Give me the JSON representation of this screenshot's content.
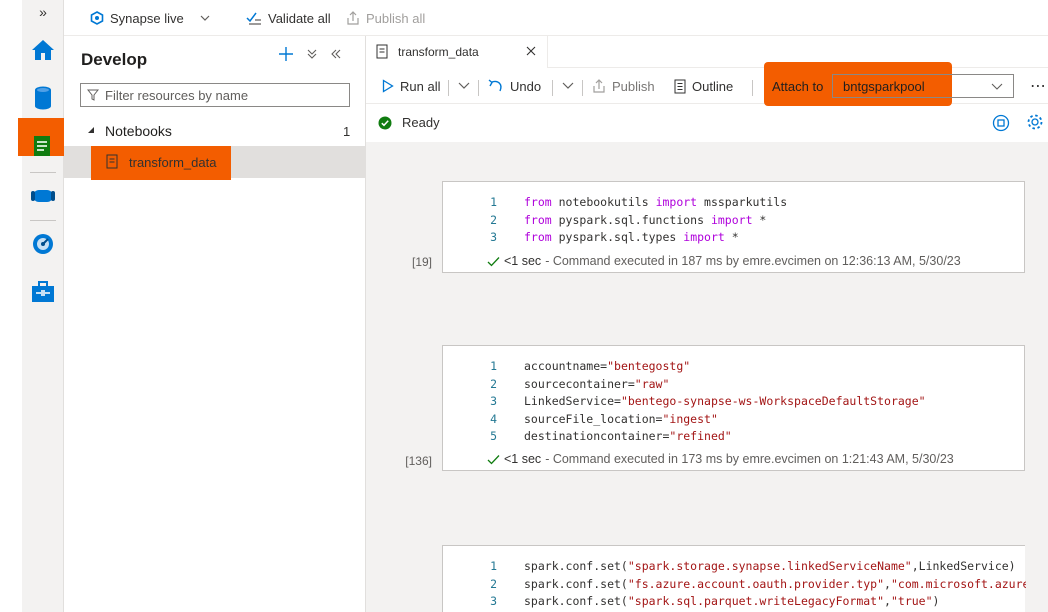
{
  "topbar": {
    "collapse_glyph": "»",
    "mode_label": "Synapse live",
    "validate_label": "Validate all",
    "publish_label": "Publish all"
  },
  "rail": {
    "items": [
      "home-icon",
      "data-icon",
      "develop-icon",
      "integrate-icon",
      "monitor-icon",
      "manage-icon"
    ]
  },
  "explorer": {
    "title": "Develop",
    "filter_placeholder": "Filter resources by name",
    "folder_label": "Notebooks",
    "folder_count": "1",
    "notebook_name": "transform_data"
  },
  "editor": {
    "tab_label": "transform_data",
    "toolbar": {
      "run_all": "Run all",
      "undo": "Undo",
      "publish": "Publish",
      "outline": "Outline",
      "attach_label": "Attach to",
      "attach_value": "bntgsparkpool"
    },
    "status": "Ready",
    "cells": [
      {
        "exec_count": "[19]",
        "status_time": "<1 sec",
        "status_text": "- Command executed in 187 ms by emre.evcimen on 12:36:13 AM, 5/30/23"
      },
      {
        "exec_count": "[136]",
        "status_time": "<1 sec",
        "status_text": "- Command executed in 173 ms by emre.evcimen on 1:21:43 AM, 5/30/23"
      },
      {
        "exec_count": "",
        "status_time": "",
        "status_text": ""
      }
    ]
  },
  "colors": {
    "accent": "#0078d4",
    "highlight": "#f35d00",
    "success": "#107c10",
    "keyword": "#af00db",
    "string": "#a31515"
  }
}
